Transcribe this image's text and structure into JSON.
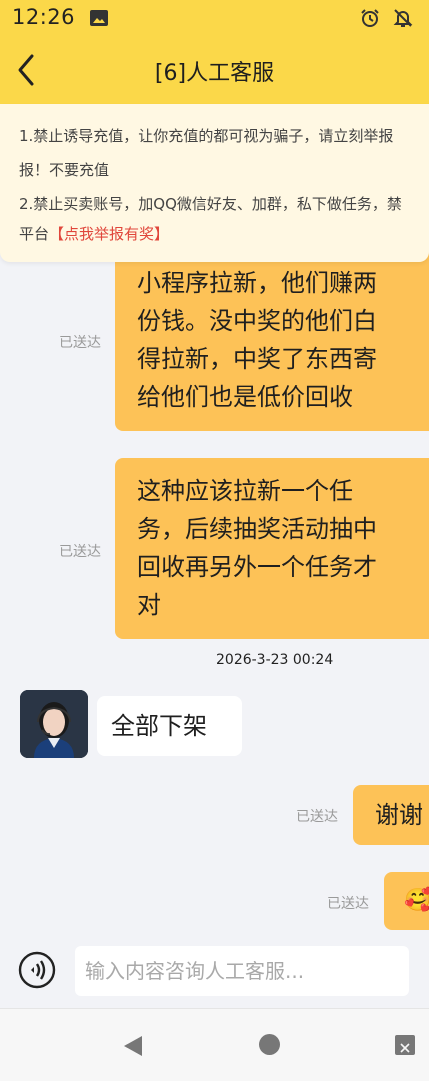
{
  "status_bar": {
    "time": "12:26"
  },
  "header": {
    "title": "[6]人工客服"
  },
  "notice": {
    "line1": "1.禁止诱导充值，让你充值的都可视为骗子，请立刻举报",
    "line2": "报！不要充值",
    "line3": "2.禁止买卖账号，加QQ微信好友、加群，私下做任务，禁",
    "line4_prefix": "平台",
    "line4_link": "【点我举报有奖】"
  },
  "messages": {
    "m1": {
      "lines": [
        "小程序拉新，他们赚两",
        "份钱。没中奖的他们白",
        "得拉新，中奖了东西寄",
        "给他们也是低价回收"
      ],
      "status": "已送达"
    },
    "m2": {
      "lines": [
        "这种应该拉新一个任",
        "务，后续抽奖活动抽中",
        "回收再另外一个任务才",
        "对"
      ],
      "status": "已送达"
    },
    "date": "2026-3-23 00:24",
    "m3": {
      "text": "全部下架"
    },
    "m4": {
      "text": "谢谢",
      "status": "已送达"
    },
    "m5": {
      "emoji": "🥰",
      "status": "已送达"
    }
  },
  "input": {
    "placeholder": "输入内容咨询人工客服..."
  },
  "colors": {
    "header": "#fbd849",
    "bubble_me": "#fdc257",
    "notice_bg": "#fff8e3",
    "link": "#e0463b"
  }
}
